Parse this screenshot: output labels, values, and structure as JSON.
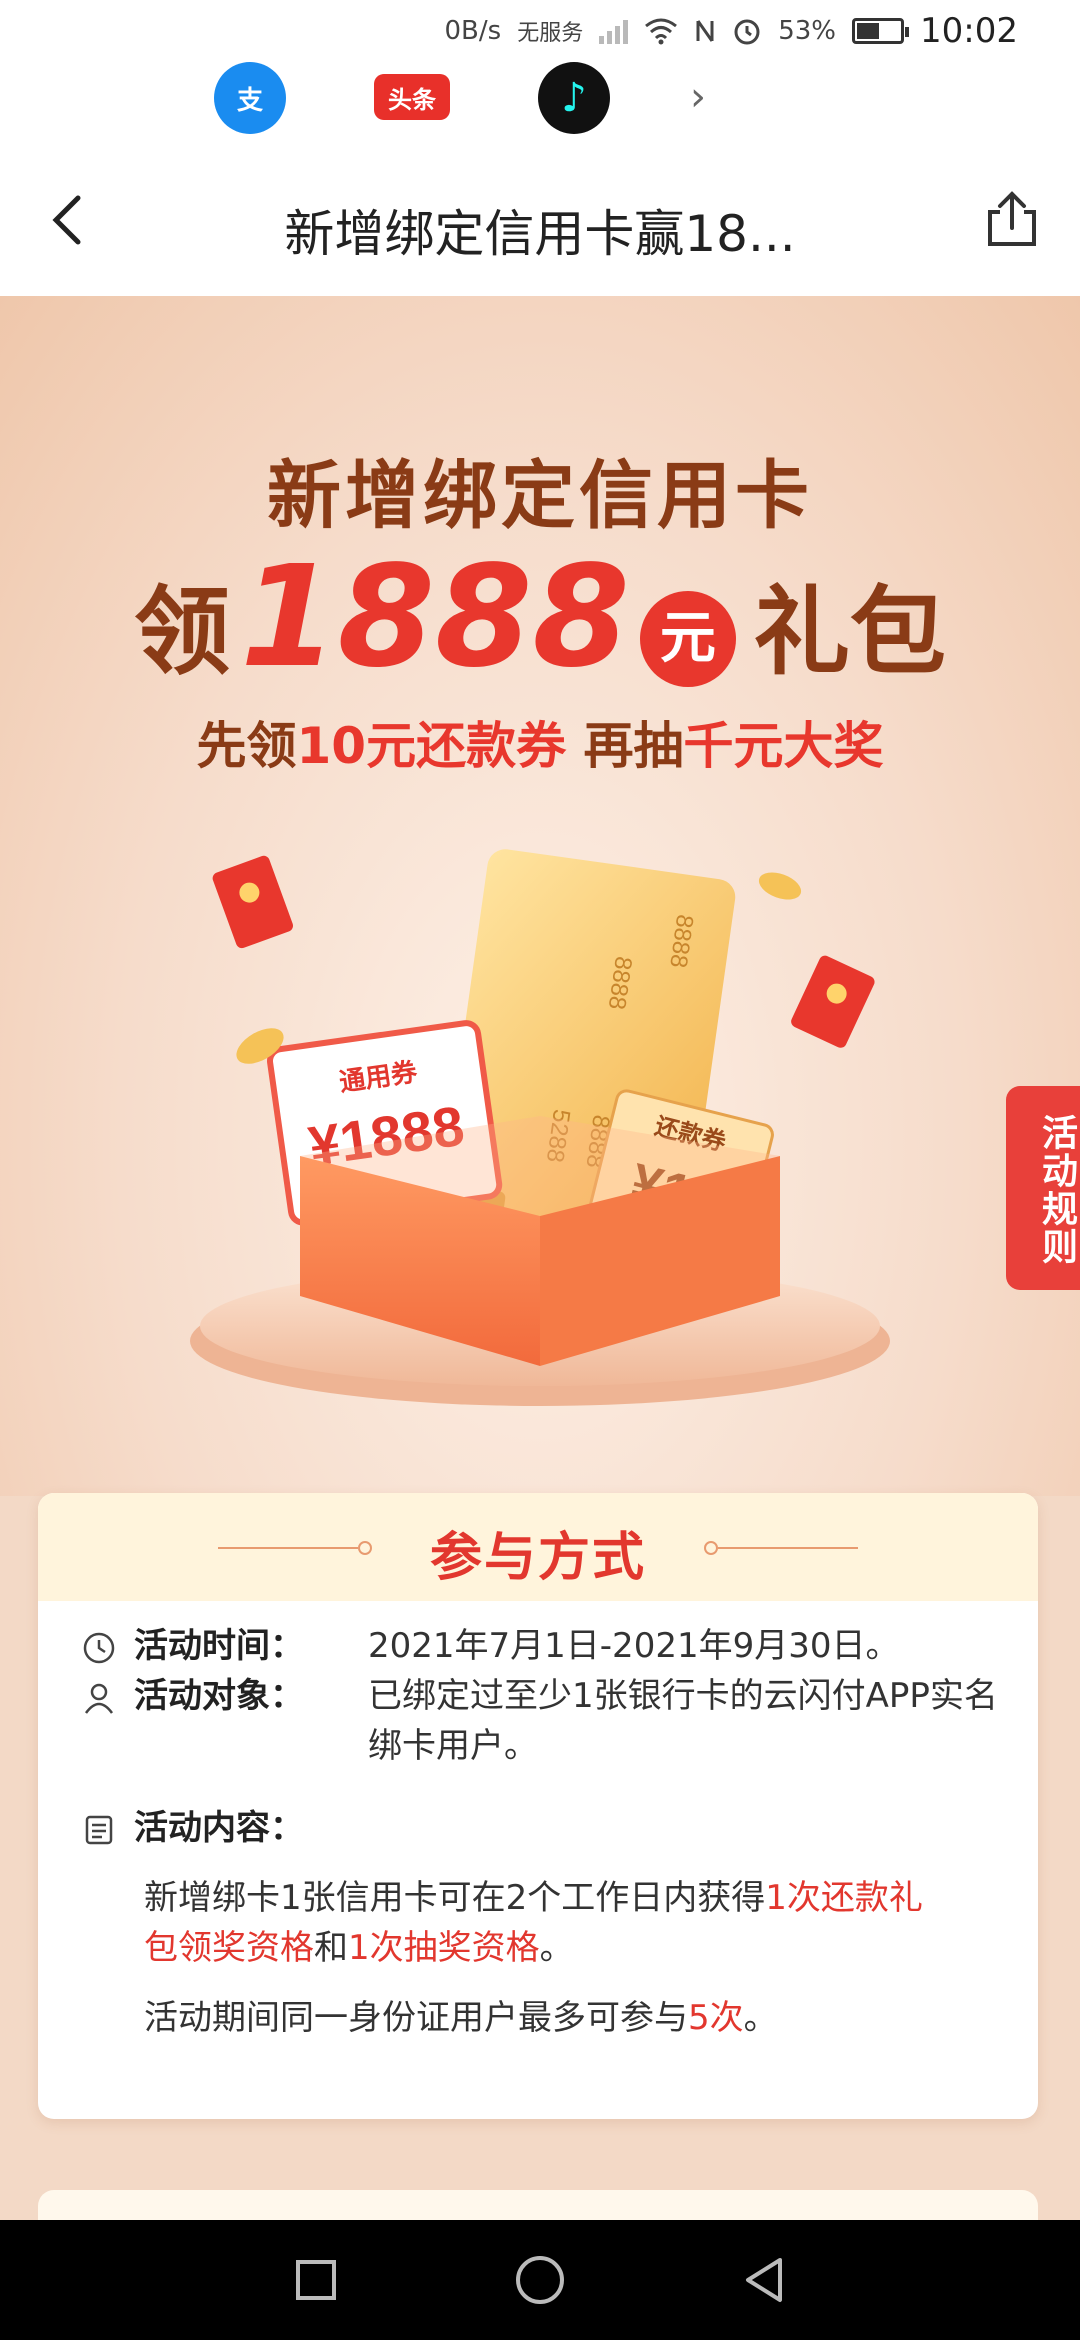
{
  "status_bar": {
    "net_speed": "0B/s",
    "carrier": "无服务",
    "battery": "53%",
    "battery_level": 0.53,
    "time": "10:02"
  },
  "app_strip": {
    "apps": [
      {
        "name": "alipay-app",
        "label": "支"
      },
      {
        "name": "toutiao-app",
        "label": "头条"
      },
      {
        "name": "tiktok-app",
        "label": "♪"
      }
    ]
  },
  "nav": {
    "title": "新增绑定信用卡赢18..."
  },
  "hero": {
    "title_line1": "新增绑定信用卡",
    "title_prefix": "领",
    "title_amount": "1888",
    "title_yuan": "元",
    "title_suffix": "礼包",
    "subtitle_part1": "先领",
    "subtitle_red1": "10元还款券",
    "subtitle_part2": "再抽",
    "subtitle_red2": "千元大奖",
    "rules_tab": "活动规则",
    "coupon_label": "通用券",
    "coupon_amount": "¥1888",
    "card_number_1": "8888",
    "card_number_2": "8888",
    "card_number_3": "5288",
    "card_number_4": "8888",
    "repay_label": "还款券",
    "repay_amount": "¥10"
  },
  "card": {
    "title": "参与方式",
    "time_label": "活动时间：",
    "time_value": "2021年7月1日-2021年9月30日。",
    "target_label": "活动对象：",
    "target_value_1": "已绑定过至少1张银行卡的云闪付APP实名",
    "target_value_2": "绑卡用户。",
    "content_label": "活动内容：",
    "content_1a": "新增绑卡1张信用卡可在2个工作日内获得",
    "content_1b": "1次还款礼",
    "content_2a": "包领奖资格",
    "content_2b": "和",
    "content_2c": "1次抽奖资格",
    "content_2d": "。",
    "content_3a": "活动期间同一身份证用户最多可参与",
    "content_3b": "5次",
    "content_3c": "。"
  },
  "colors": {
    "accent_red": "#e2372e",
    "brown": "#8a3b16",
    "hero_bg": "#f6dccb"
  }
}
